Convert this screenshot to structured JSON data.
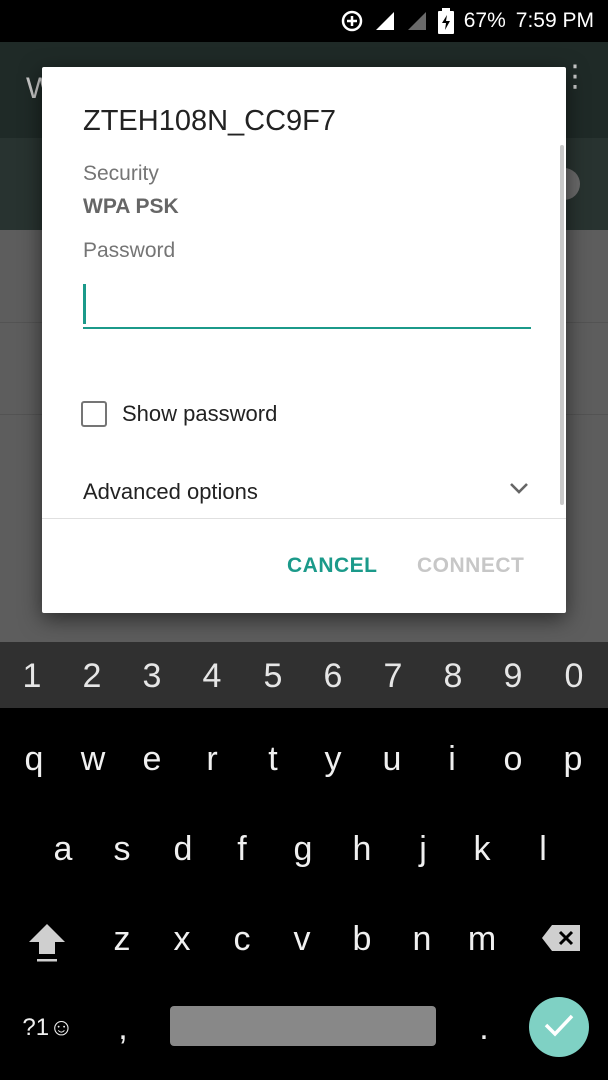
{
  "status_bar": {
    "battery": "67%",
    "time": "7:59 PM",
    "icons": [
      "data-saver-icon",
      "signal-icon",
      "signal-empty-icon",
      "battery-charging-icon"
    ]
  },
  "background": {
    "toolbar_initial": "W",
    "more_icon": "more-vert-icon"
  },
  "dialog": {
    "title": "ZTEH108N_CC9F7",
    "security_label": "Security",
    "security_value": "WPA PSK",
    "password_label": "Password",
    "password_value": "",
    "show_password_label": "Show password",
    "show_password_checked": false,
    "advanced_label": "Advanced options",
    "cancel_label": "CANCEL",
    "connect_label": "CONNECT",
    "accent_color": "#1b9a8a"
  },
  "keyboard": {
    "numbers": [
      "1",
      "2",
      "3",
      "4",
      "5",
      "6",
      "7",
      "8",
      "9",
      "0"
    ],
    "row1": [
      "q",
      "w",
      "e",
      "r",
      "t",
      "y",
      "u",
      "i",
      "o",
      "p"
    ],
    "row2": [
      "a",
      "s",
      "d",
      "f",
      "g",
      "h",
      "j",
      "k",
      "l"
    ],
    "row3": [
      "z",
      "x",
      "c",
      "v",
      "b",
      "n",
      "m"
    ],
    "symbols_label": "?1☺",
    "comma": ",",
    "period": "."
  }
}
